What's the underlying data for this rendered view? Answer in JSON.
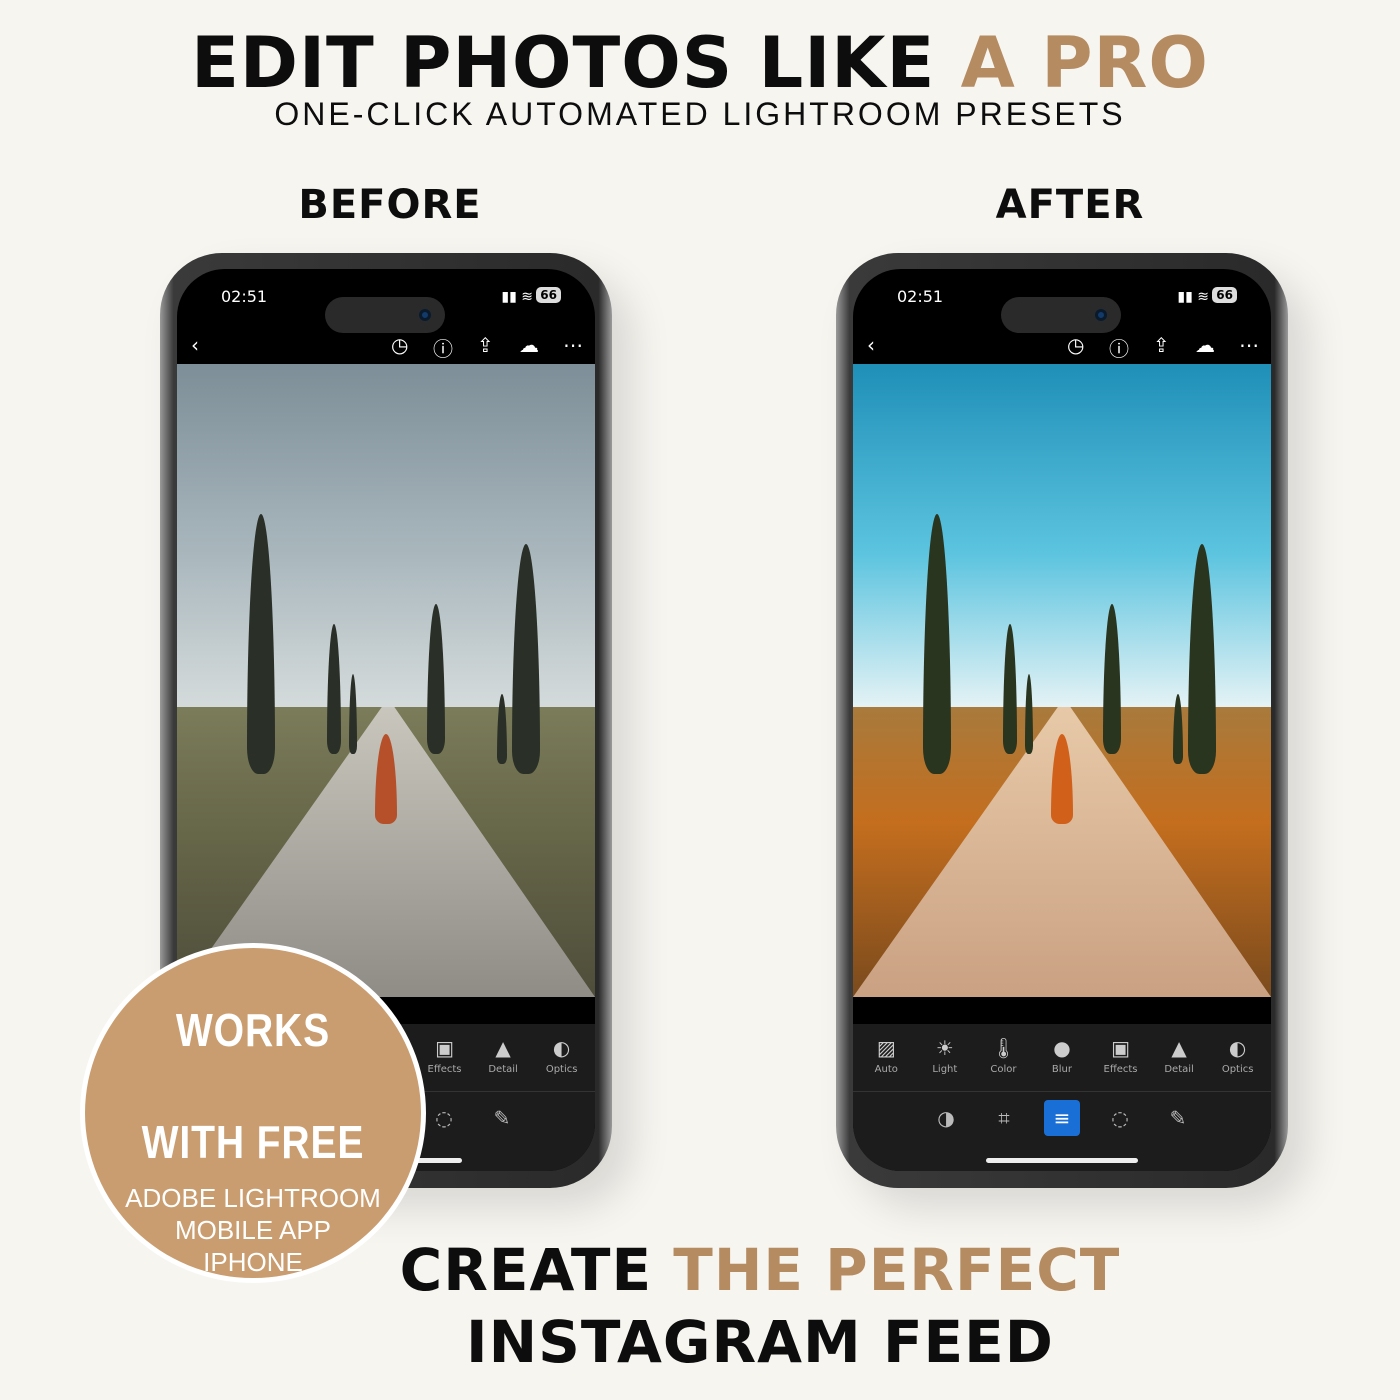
{
  "headline": {
    "part1": "EDIT PHOTOS LIKE ",
    "part2": "A PRO"
  },
  "subtitle": "ONE-CLICK AUTOMATED LIGHTROOM PRESETS",
  "labels": {
    "before": "BEFORE",
    "after": "AFTER"
  },
  "phone": {
    "time": "02:51",
    "battery": "66",
    "top_icons": [
      "back-icon",
      "history-icon",
      "help-icon",
      "share-icon",
      "cloud-sync-icon",
      "more-icon"
    ],
    "tools": [
      {
        "label": "Auto",
        "icon": "auto-icon"
      },
      {
        "label": "Light",
        "icon": "sun-icon"
      },
      {
        "label": "Color",
        "icon": "thermometer-icon"
      },
      {
        "label": "Blur",
        "icon": "drop-icon"
      },
      {
        "label": "Effects",
        "icon": "vignette-icon"
      },
      {
        "label": "Detail",
        "icon": "triangle-icon"
      },
      {
        "label": "Optics",
        "icon": "lens-icon"
      }
    ],
    "modes": [
      "presets-icon",
      "crop-icon",
      "edit-icon",
      "masking-icon",
      "healing-icon"
    ],
    "active_mode": "edit-icon",
    "accent": "#1a6fd6"
  },
  "badge": {
    "line1": "WORKS",
    "line2": "WITH FREE",
    "line3": "ADOBE LIGHTROOM",
    "line4": "MOBILE APP",
    "line5": "IPHONE"
  },
  "footer": {
    "part1": "CREATE ",
    "part2": "THE PERFECT",
    "line2": "INSTAGRAM FEED"
  },
  "colors": {
    "accent": "#b58c62",
    "badge": "#c99d6f",
    "background": "#f7f5f0"
  }
}
